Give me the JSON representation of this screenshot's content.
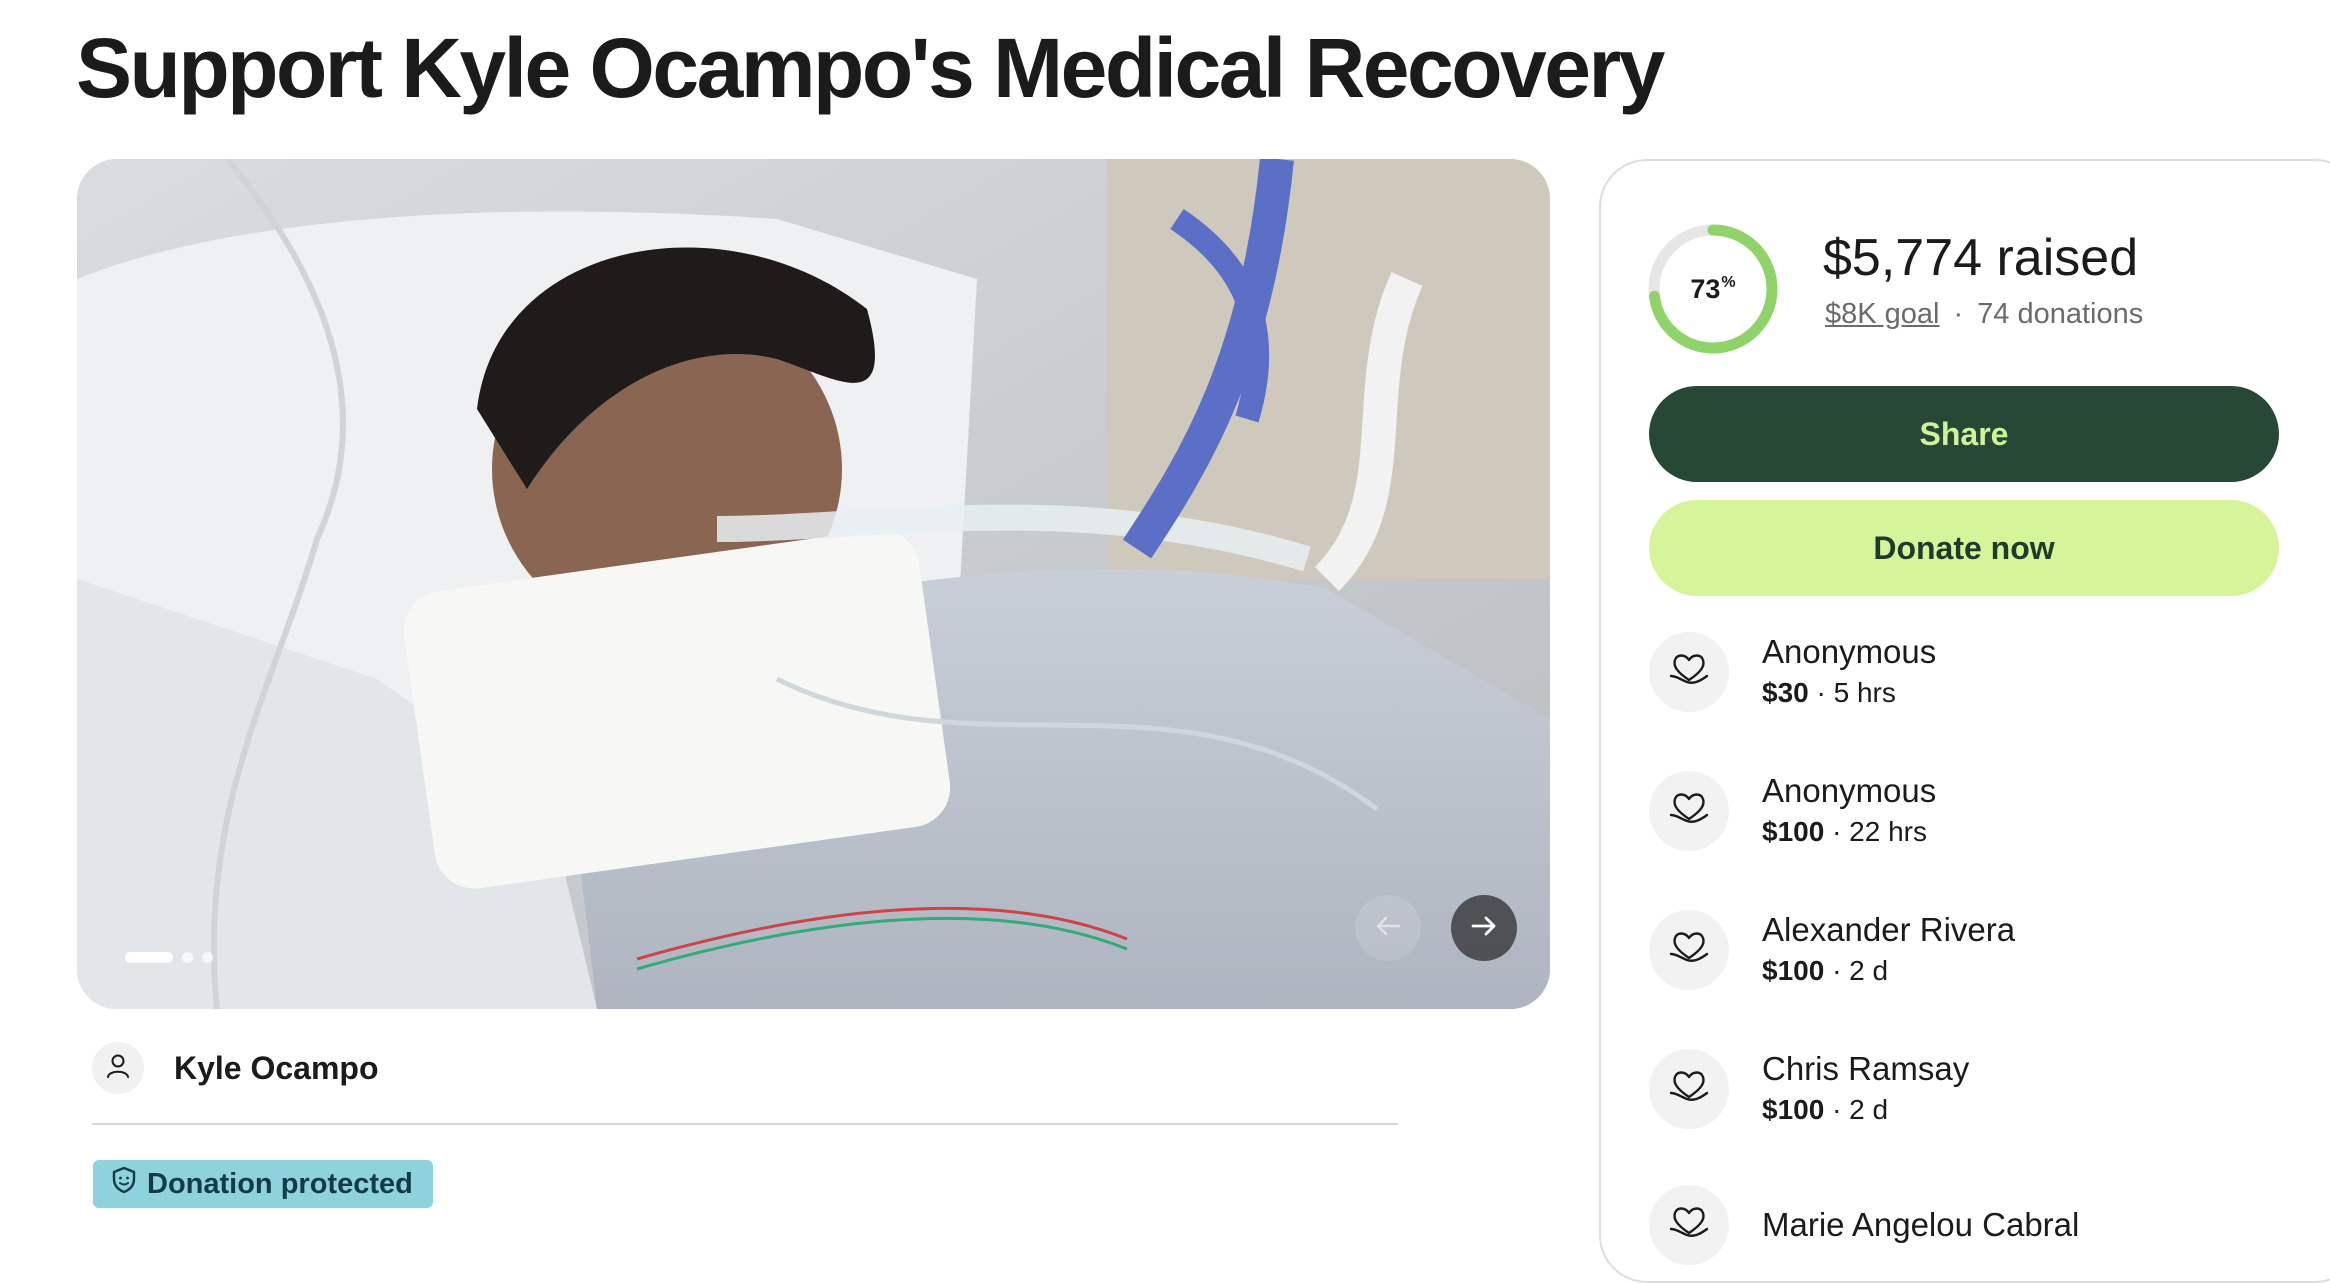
{
  "page": {
    "title": "Support Kyle Ocampo's Medical Recovery"
  },
  "gallery": {
    "slide_count": 3,
    "active_slide": 1
  },
  "organizer": {
    "name": "Kyle Ocampo"
  },
  "badge": {
    "label": "Donation protected"
  },
  "progress": {
    "percent_label": "73",
    "percent_symbol": "%",
    "fraction": 0.73,
    "raised": "$5,774 raised",
    "goal": "$8K goal",
    "separator": "·",
    "donations": "74 donations"
  },
  "actions": {
    "share_label": "Share",
    "donate_label": "Donate now"
  },
  "donations": [
    {
      "name": "Anonymous",
      "amount": "$30",
      "time": "· 5 hrs"
    },
    {
      "name": "Anonymous",
      "amount": "$100",
      "time": "· 22 hrs"
    },
    {
      "name": "Alexander Rivera",
      "amount": "$100",
      "time": "· 2 d"
    },
    {
      "name": "Chris Ramsay",
      "amount": "$100",
      "time": "· 2 d"
    },
    {
      "name": "Marie Angelou Cabral",
      "amount": "",
      "time": ""
    }
  ],
  "colors": {
    "share_bg": "#274835",
    "share_text": "#cdf39b",
    "donate_bg": "#d6f59a",
    "donate_text": "#1f3b2b",
    "progress": "#8fd36a",
    "progress_track": "#e6e6e6",
    "badge_bg": "#8ed2dc"
  },
  "icons": {
    "organizer": "user-icon",
    "badge": "shield-icon",
    "donation": "heart-hand-icon",
    "prev": "arrow-left-icon",
    "next": "arrow-right-icon"
  }
}
